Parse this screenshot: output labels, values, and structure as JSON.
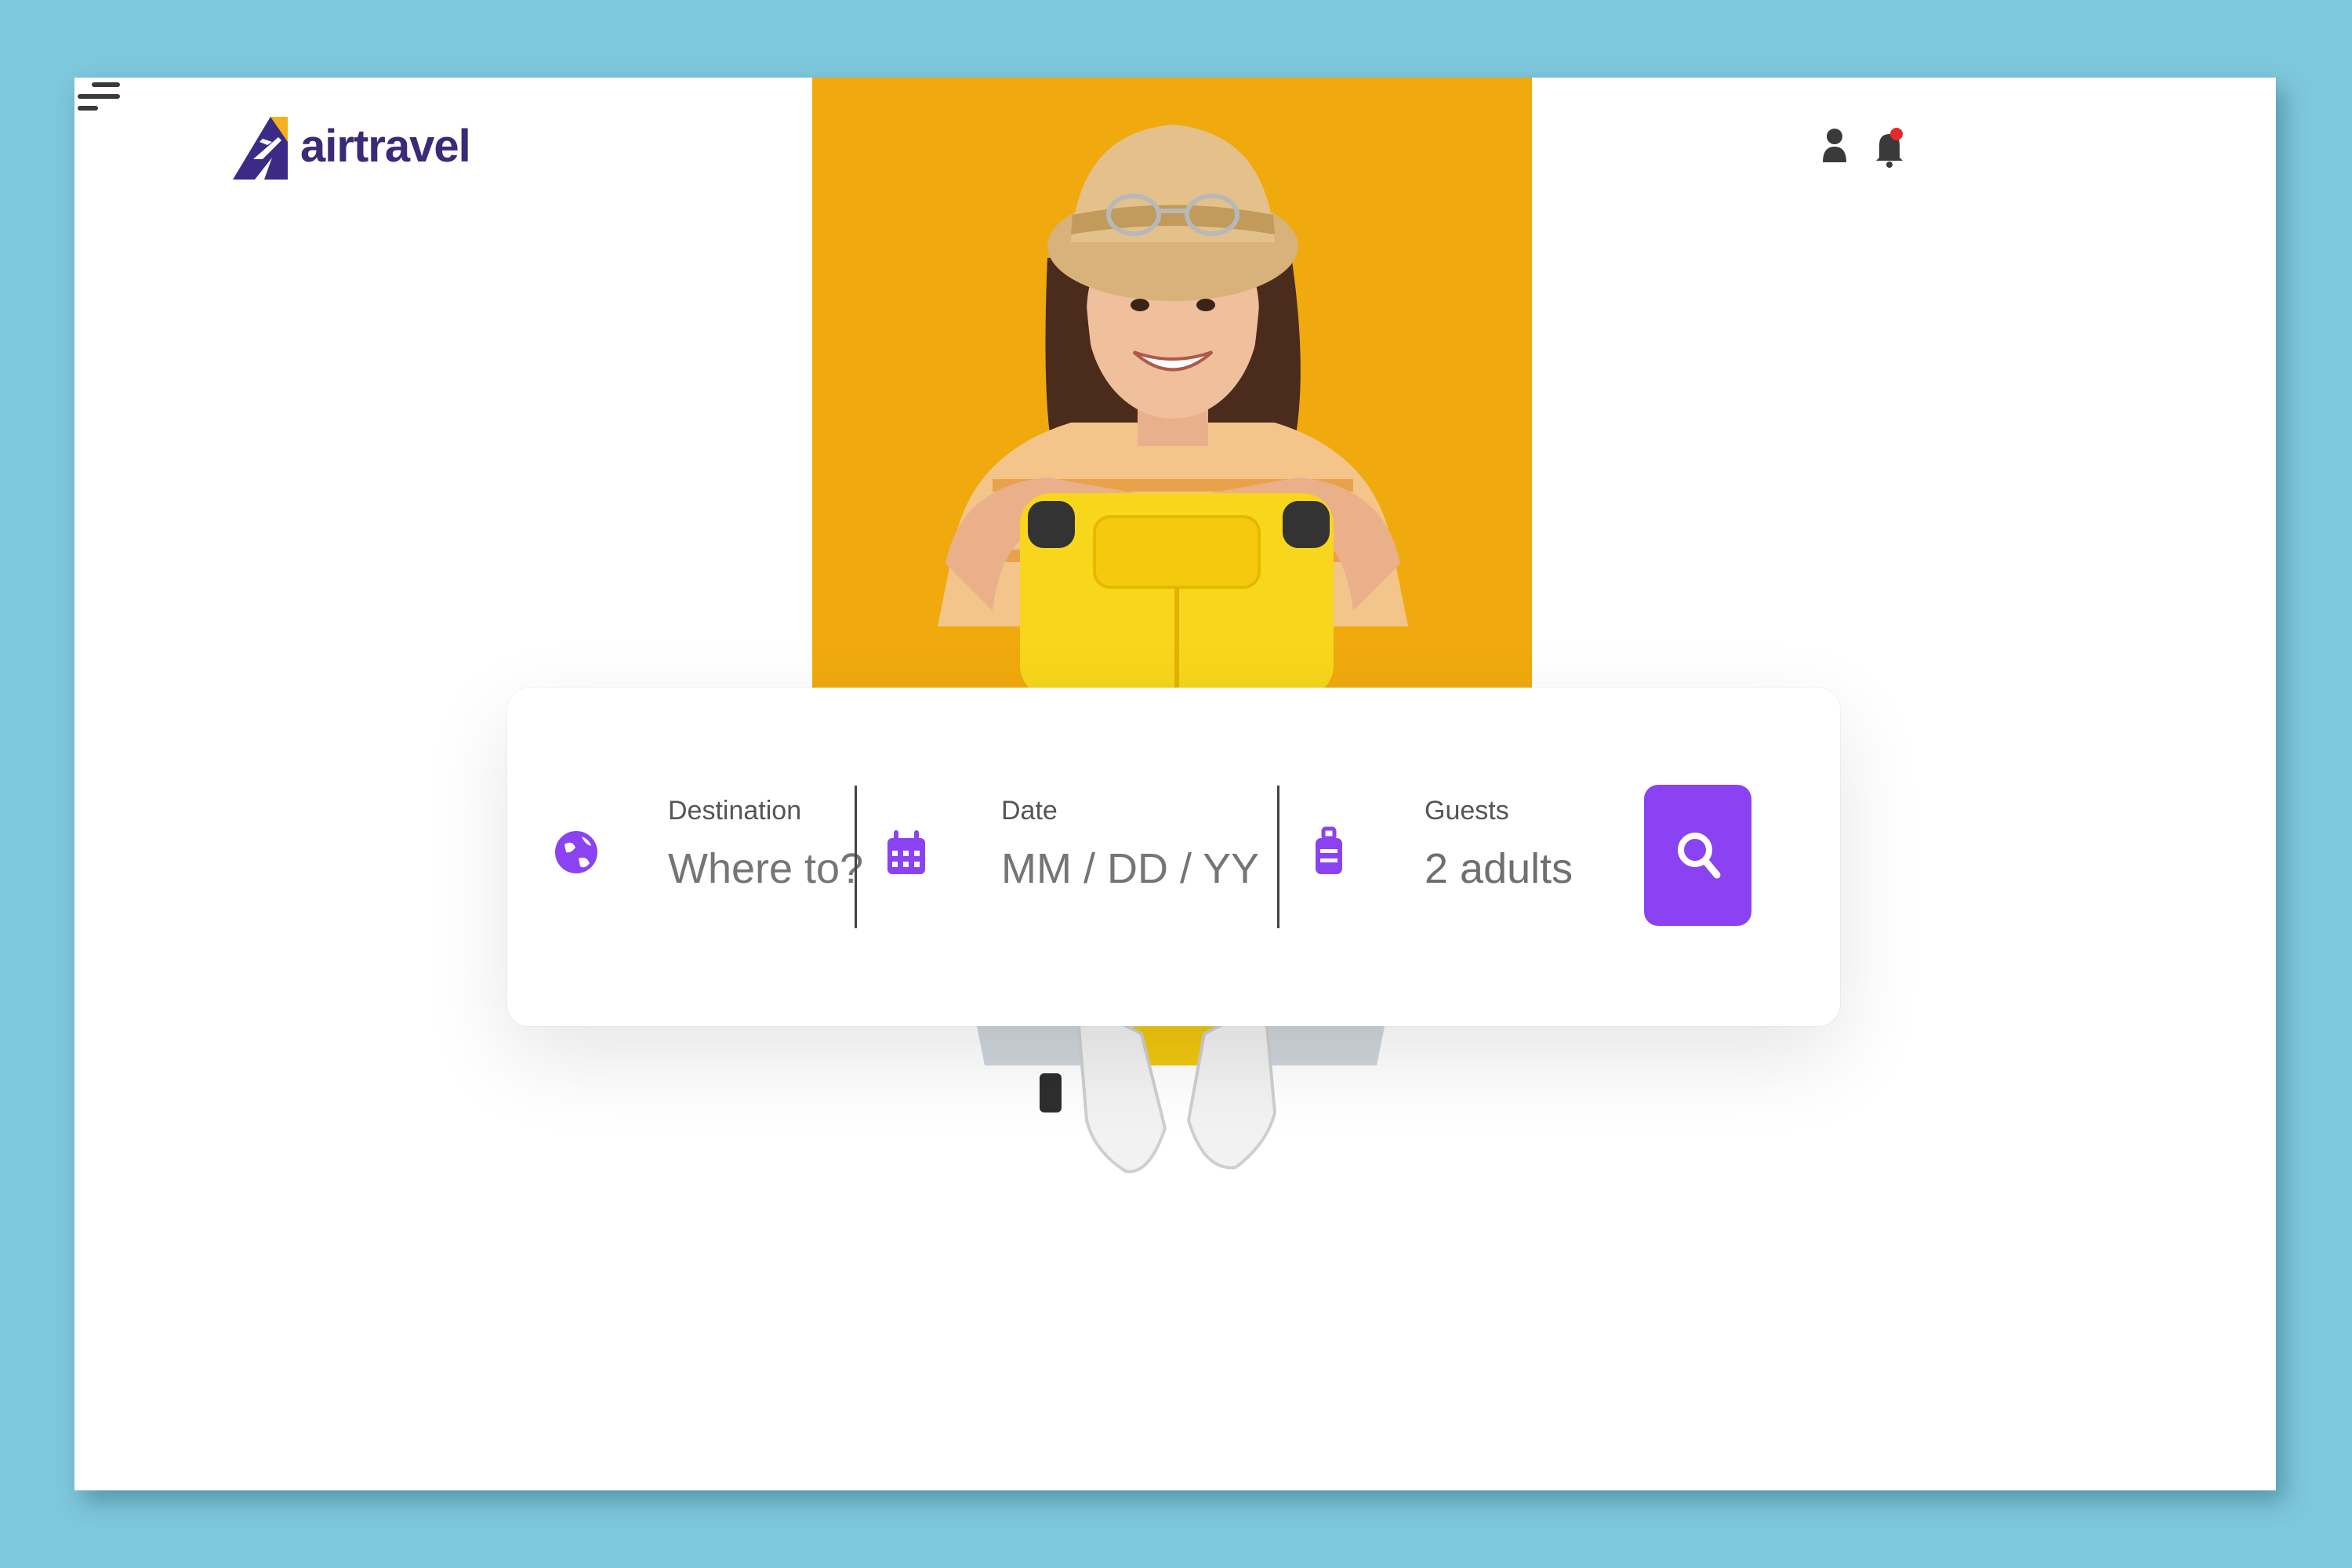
{
  "brand": {
    "name": "airtravel",
    "accent": "#8a42f3",
    "logo_color": "#3a2a78"
  },
  "header": {
    "icons": [
      "user-icon",
      "bell-icon",
      "menu-icon"
    ],
    "notification_dot_color": "#e8282b"
  },
  "hero": {
    "background": "#f0aa0d"
  },
  "search": {
    "destination": {
      "label": "Destination",
      "placeholder": "Where to?",
      "icon": "globe-icon"
    },
    "date": {
      "label": "Date",
      "placeholder": "MM / DD / YY",
      "icon": "calendar-icon"
    },
    "guests": {
      "label": "Guests",
      "value": "2 adults",
      "icon": "luggage-icon"
    },
    "button_icon": "search-icon"
  }
}
